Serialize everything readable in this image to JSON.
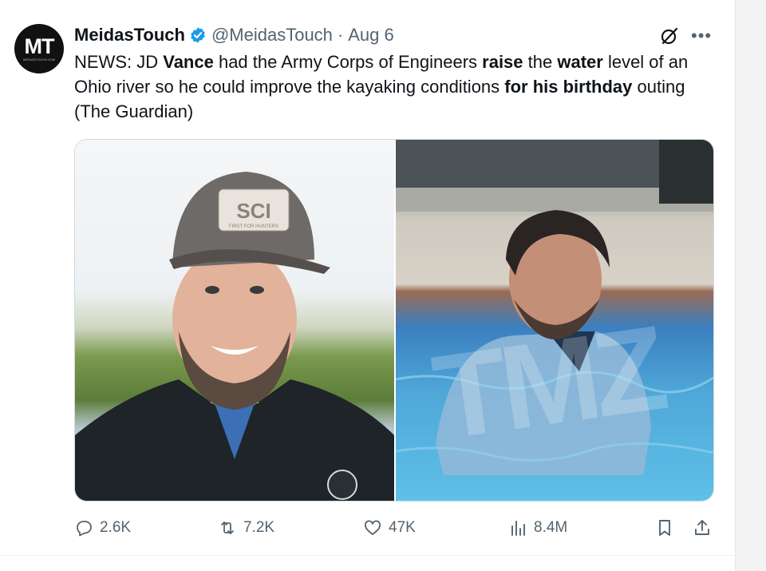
{
  "tweet": {
    "avatar_text": "MT",
    "avatar_sub": "MEIDASTOUCH.COM",
    "author_name": "MeidasTouch",
    "handle": "@MeidasTouch",
    "separator": "·",
    "date": "Aug 6",
    "text_parts": {
      "p1": "NEWS: JD ",
      "b1": "Vance",
      "p2": " had the Army Corps of Engineers ",
      "b2": "raise",
      "p3": " the ",
      "b3": "water",
      "p4": " level of an Ohio river so he could improve the kayaking conditions ",
      "b4": "for his birthday",
      "p5": " outing (The Guardian)"
    },
    "media": {
      "left_cap_text": "SCI",
      "left_cap_subtext": "FIRST FOR HUNTERS",
      "right_watermark": "TMZ"
    },
    "actions": {
      "replies": "2.6K",
      "reposts": "7.2K",
      "likes": "47K",
      "views": "8.4M"
    }
  },
  "icons": {
    "verified": "verified-badge-icon",
    "grok": "grok-icon",
    "more": "more-icon",
    "reply": "reply-icon",
    "repost": "repost-icon",
    "like": "like-icon",
    "views": "views-icon",
    "bookmark": "bookmark-icon",
    "share": "share-icon"
  },
  "colors": {
    "verified_blue": "#1d9bf0",
    "secondary_text": "#536471",
    "primary_text": "#0f1419"
  }
}
